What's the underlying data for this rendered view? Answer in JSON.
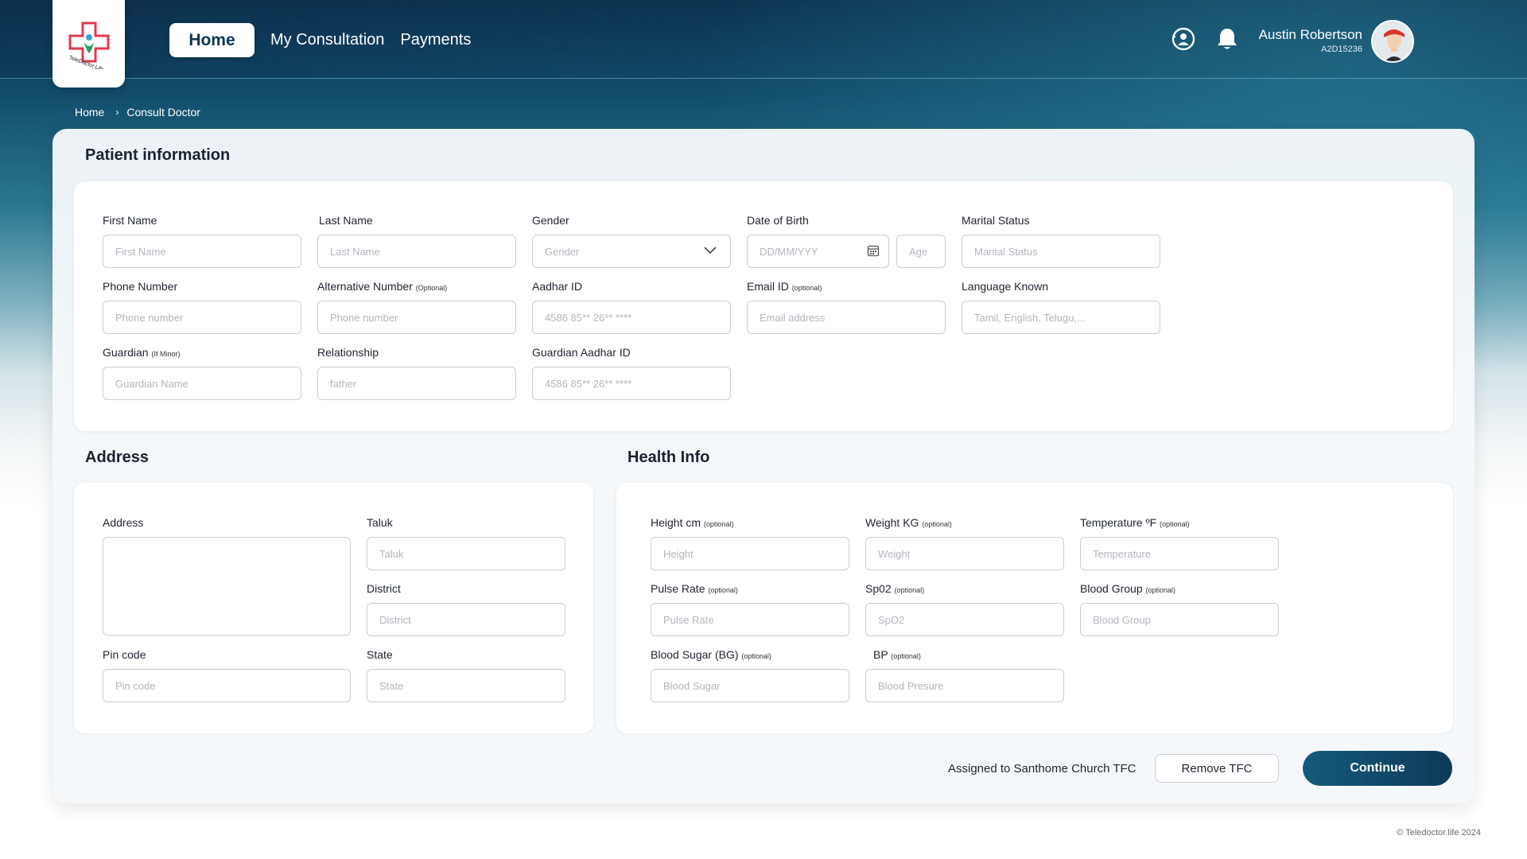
{
  "header": {
    "logo_text": "TeleDoctor.Life",
    "nav": {
      "home": "Home",
      "consultation": "My Consultation",
      "payments": "Payments"
    },
    "user": {
      "name": "Austin Robertson",
      "id": "A2D15236"
    }
  },
  "breadcrumb": {
    "home": "Home",
    "current": "Consult Doctor"
  },
  "patient": {
    "title": "Patient information",
    "first_name": {
      "label": "First Name",
      "placeholder": "First Name"
    },
    "last_name": {
      "label": "Last Name",
      "placeholder": "Last Name"
    },
    "gender": {
      "label": "Gender",
      "placeholder": "Gender"
    },
    "dob": {
      "label": "Date of Birth",
      "placeholder": "DD/MM/YYY",
      "age_placeholder": "Age"
    },
    "marital": {
      "label": "Marital Status",
      "placeholder": "Marital Status"
    },
    "phone": {
      "label": "Phone Number",
      "placeholder": "Phone number"
    },
    "alt_phone": {
      "label": "Alternative Number",
      "note": "(Optional)",
      "placeholder": "Phone number"
    },
    "aadhar": {
      "label": "Aadhar ID",
      "placeholder": "4586 85** 26** ****"
    },
    "email": {
      "label": "Email ID",
      "note": "(optional)",
      "placeholder": "Email address"
    },
    "language": {
      "label": "Language Known",
      "placeholder": "Tamil, English, Telugu,..."
    },
    "guardian": {
      "label": "Guardian",
      "note": "(If Minor)",
      "placeholder": "Guardian Name"
    },
    "relationship": {
      "label": "Relationship",
      "placeholder": "father"
    },
    "guardian_aadhar": {
      "label": "Guardian Aadhar ID",
      "placeholder": "4586 85** 26** ****"
    }
  },
  "address": {
    "title": "Address",
    "address": {
      "label": "Address"
    },
    "taluk": {
      "label": "Taluk",
      "placeholder": "Taluk"
    },
    "district": {
      "label": "District",
      "placeholder": "District"
    },
    "pincode": {
      "label": "Pin code",
      "placeholder": "Pin code"
    },
    "state": {
      "label": "State",
      "placeholder": "State"
    }
  },
  "health": {
    "title": "Health Info",
    "height": {
      "label": "Height cm",
      "note": "(optional)",
      "placeholder": "Height"
    },
    "weight": {
      "label": "Weight KG",
      "note": "(optional)",
      "placeholder": "Weight"
    },
    "temperature": {
      "label": "Temperature ºF",
      "note": "(optional)",
      "placeholder": "Temperature"
    },
    "pulse": {
      "label": "Pulse Rate",
      "note": "(optional)",
      "placeholder": "Pulse Rate"
    },
    "spo2": {
      "label": "Sp02",
      "note": "(optional)",
      "placeholder": "SpO2"
    },
    "blood_group": {
      "label": "Blood Group",
      "note": "(optional)",
      "placeholder": "Blood Group"
    },
    "blood_sugar": {
      "label": "Blood Sugar (BG)",
      "note": "(optional)",
      "placeholder": "Blood Sugar"
    },
    "bp": {
      "label": "BP",
      "note": "(optional)",
      "placeholder": "Blood Presure"
    }
  },
  "actions": {
    "assigned_text": "Assigned to Santhome Church TFC",
    "remove": "Remove TFC",
    "continue": "Continue"
  },
  "footer": {
    "copyright": "© Teledoctor.life 2024"
  },
  "colors": {
    "primary": "#0e3a58",
    "accent": "#e23a4e",
    "field_border": "#c9ced6"
  }
}
